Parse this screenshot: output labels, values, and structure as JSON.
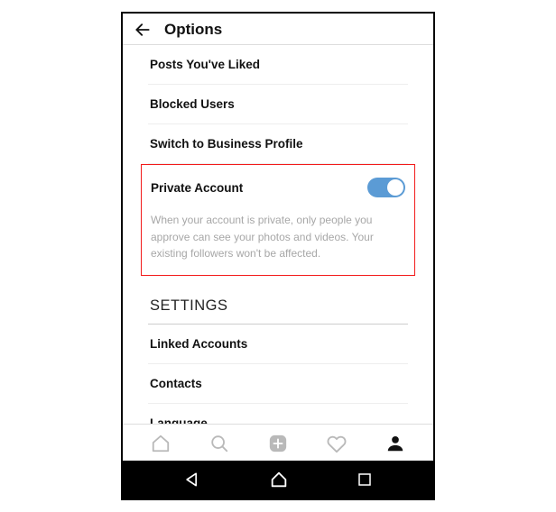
{
  "header": {
    "title": "Options"
  },
  "options": {
    "posts_liked": "Posts You've Liked",
    "blocked_users": "Blocked Users",
    "switch_business": "Switch to Business Profile",
    "private_account": "Private Account",
    "private_account_desc": "When your account is private, only people you approve can see your photos and videos. Your existing followers won't be affected.",
    "private_toggle_on": true
  },
  "section": {
    "settings": "SETTINGS"
  },
  "settings": {
    "linked_accounts": "Linked Accounts",
    "contacts": "Contacts",
    "language": "Language"
  }
}
